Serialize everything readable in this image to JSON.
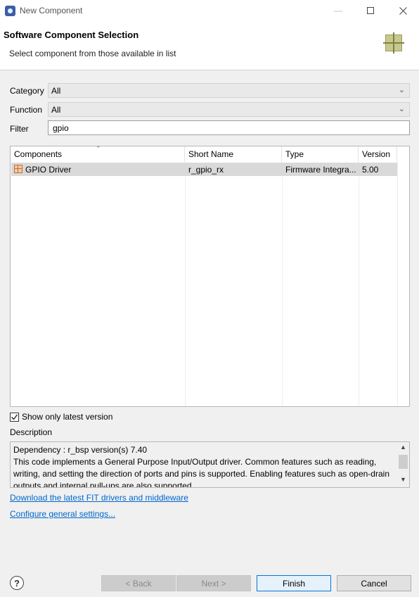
{
  "window": {
    "title": "New Component"
  },
  "header": {
    "title": "Software Component Selection",
    "subtitle": "Select component from those available in list"
  },
  "fields": {
    "category_label": "Category",
    "category_value": "All",
    "function_label": "Function",
    "function_value": "All",
    "filter_label": "Filter",
    "filter_value": "gpio"
  },
  "table": {
    "columns": [
      "Components",
      "Short Name",
      "Type",
      "Version"
    ],
    "rows": [
      {
        "component": "GPIO Driver",
        "short_name": "r_gpio_rx",
        "type": "Firmware Integra...",
        "version": "5.00"
      }
    ]
  },
  "options": {
    "latest_only_label": "Show only latest version",
    "latest_only_checked": true
  },
  "description": {
    "label": "Description",
    "line1": "Dependency : r_bsp version(s) 7.40",
    "body": "This code implements a General Purpose Input/Output driver. Common features such as reading, writing, and setting the direction of ports and pins is supported. Enabling features such as open-drain outputs and internal pull-ups are also supported."
  },
  "links": {
    "download": "Download the latest FIT drivers and middleware",
    "configure": "Configure general settings..."
  },
  "buttons": {
    "help": "?",
    "back": "< Back",
    "next": "Next >",
    "finish": "Finish",
    "cancel": "Cancel"
  },
  "colors": {
    "link": "#0066cc",
    "primary_border": "#0078d7",
    "selected_row": "#d9d9d9"
  },
  "icons": {
    "app": "app-icon",
    "component": "component-icon",
    "row": "component-grid-icon",
    "minimize": "minimize-icon",
    "maximize": "maximize-icon",
    "close": "close-icon",
    "dropdown": "chevron-down-icon",
    "check": "checkmark-icon",
    "help": "help-icon"
  }
}
